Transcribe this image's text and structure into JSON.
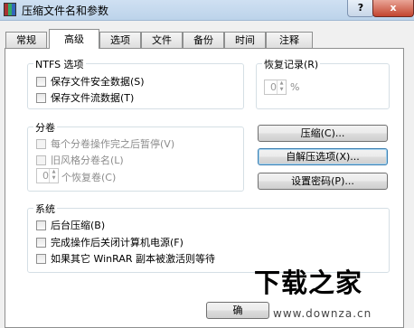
{
  "window": {
    "title": "压缩文件名和参数",
    "help_label": "?",
    "close_label": "x"
  },
  "tabs": [
    {
      "label": "常规"
    },
    {
      "label": "高级",
      "active": true
    },
    {
      "label": "选项"
    },
    {
      "label": "文件"
    },
    {
      "label": "备份"
    },
    {
      "label": "时间"
    },
    {
      "label": "注释"
    }
  ],
  "ntfs": {
    "title": "NTFS 选项",
    "items": [
      {
        "label": "保存文件安全数据(S)",
        "checked": false
      },
      {
        "label": "保存文件流数据(T)",
        "checked": false
      }
    ]
  },
  "recovery": {
    "title": "恢复记录(R)",
    "value": "0",
    "unit": "%"
  },
  "split": {
    "title": "分卷",
    "items": [
      {
        "label": "每个分卷操作完之后暂停(V)",
        "checked": false,
        "disabled": true
      },
      {
        "label": "旧风格分卷名(L)",
        "checked": false,
        "disabled": true
      }
    ],
    "recovery_volumes_value": "0",
    "recovery_volumes_label": "个恢复卷(C)"
  },
  "buttons": {
    "compression": "压缩(C)...",
    "sfx_options": "自解压选项(X)...",
    "set_password": "设置密码(P)..."
  },
  "system": {
    "title": "系统",
    "items": [
      {
        "label": "后台压缩(B)",
        "checked": false
      },
      {
        "label": "完成操作后关闭计算机电源(F)",
        "checked": false
      },
      {
        "label": "如果其它 WinRAR 副本被激活则等待",
        "checked": false
      }
    ]
  },
  "footer": {
    "ok_label_partial": "确"
  },
  "watermark": {
    "logo_text": "下载之家",
    "url": "www.downza.cn"
  }
}
